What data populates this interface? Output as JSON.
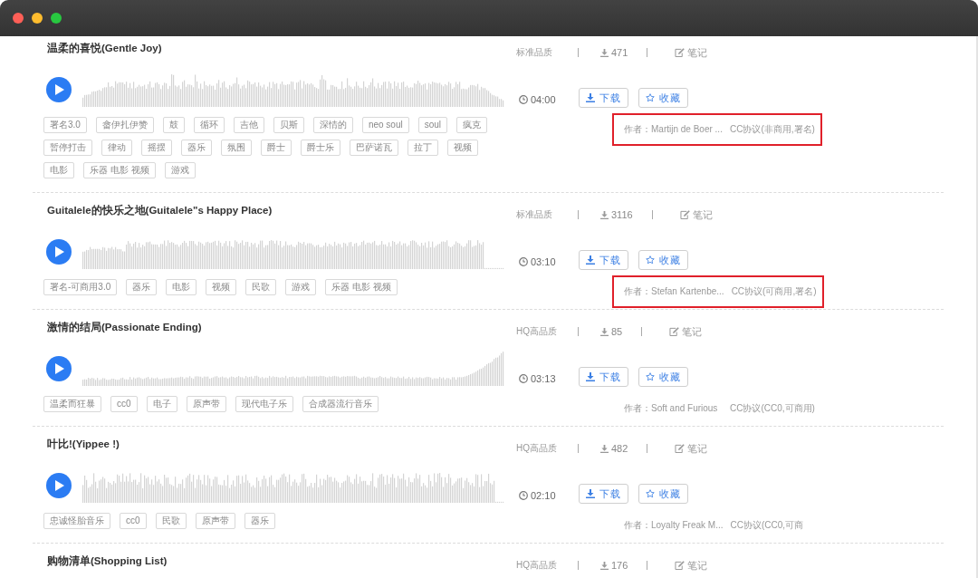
{
  "tracks": [
    {
      "title": "温柔的喜悦(Gentle Joy)",
      "quality": "标准品质",
      "downloads": "471",
      "note": "笔记",
      "duration": "04:00",
      "download_button": "下载",
      "favorite_button": "收藏",
      "tags": [
        "署名3.0",
        "畲伊扎伊赞",
        "鼓",
        "循环",
        "吉他",
        "贝斯",
        "深情的",
        "neo soul",
        "soul",
        "疯克",
        "暂停打击",
        "律动",
        "摇摆",
        "器乐",
        "氛围",
        "爵士",
        "爵士乐",
        "巴萨诺瓦",
        "拉丁",
        "视频",
        "电影",
        "乐器 电影 视频",
        "游戏"
      ],
      "credit": {
        "author": "作者：Martijn de Boer ...",
        "license": "CC协议(非商用,署名)",
        "highlighted": true
      }
    },
    {
      "title": "Guitalele的快乐之地(Guitalele\"s Happy Place)",
      "quality": "标准品质",
      "downloads": "3116",
      "note": "笔记",
      "duration": "03:10",
      "download_button": "下载",
      "favorite_button": "收藏",
      "tags": [
        "署名-可商用3.0",
        "器乐",
        "电影",
        "视频",
        "民歌",
        "游戏",
        "乐器 电影 视频"
      ],
      "credit": {
        "author": "作者：Stefan Kartenbe...",
        "license": "CC协议(可商用,署名)",
        "highlighted": true
      }
    },
    {
      "title": "激情的结局(Passionate Ending)",
      "quality": "HQ高品质",
      "downloads": "85",
      "note": "笔记",
      "duration": "03:13",
      "download_button": "下载",
      "favorite_button": "收藏",
      "tags": [
        "温柔而狂暴",
        "cc0",
        "电子",
        "原声带",
        "现代电子乐",
        "合成器流行音乐"
      ],
      "credit": {
        "author": "作者：Soft and Furious",
        "license": "CC协议(CC0,可商用)",
        "highlighted": false
      }
    },
    {
      "title": "叶比!(Yippee !)",
      "quality": "HQ高品质",
      "downloads": "482",
      "note": "笔记",
      "duration": "02:10",
      "download_button": "下载",
      "favorite_button": "收藏",
      "tags": [
        "忠诚怪胎音乐",
        "cc0",
        "民歌",
        "原声带",
        "器乐"
      ],
      "credit": {
        "author": "作者：Loyalty Freak M...",
        "license": "CC协议(CC0,可商",
        "highlighted": false
      }
    },
    {
      "title": "购物清单(Shopping List)",
      "quality": "HQ高品质",
      "downloads": "176",
      "note": "笔记"
    }
  ]
}
